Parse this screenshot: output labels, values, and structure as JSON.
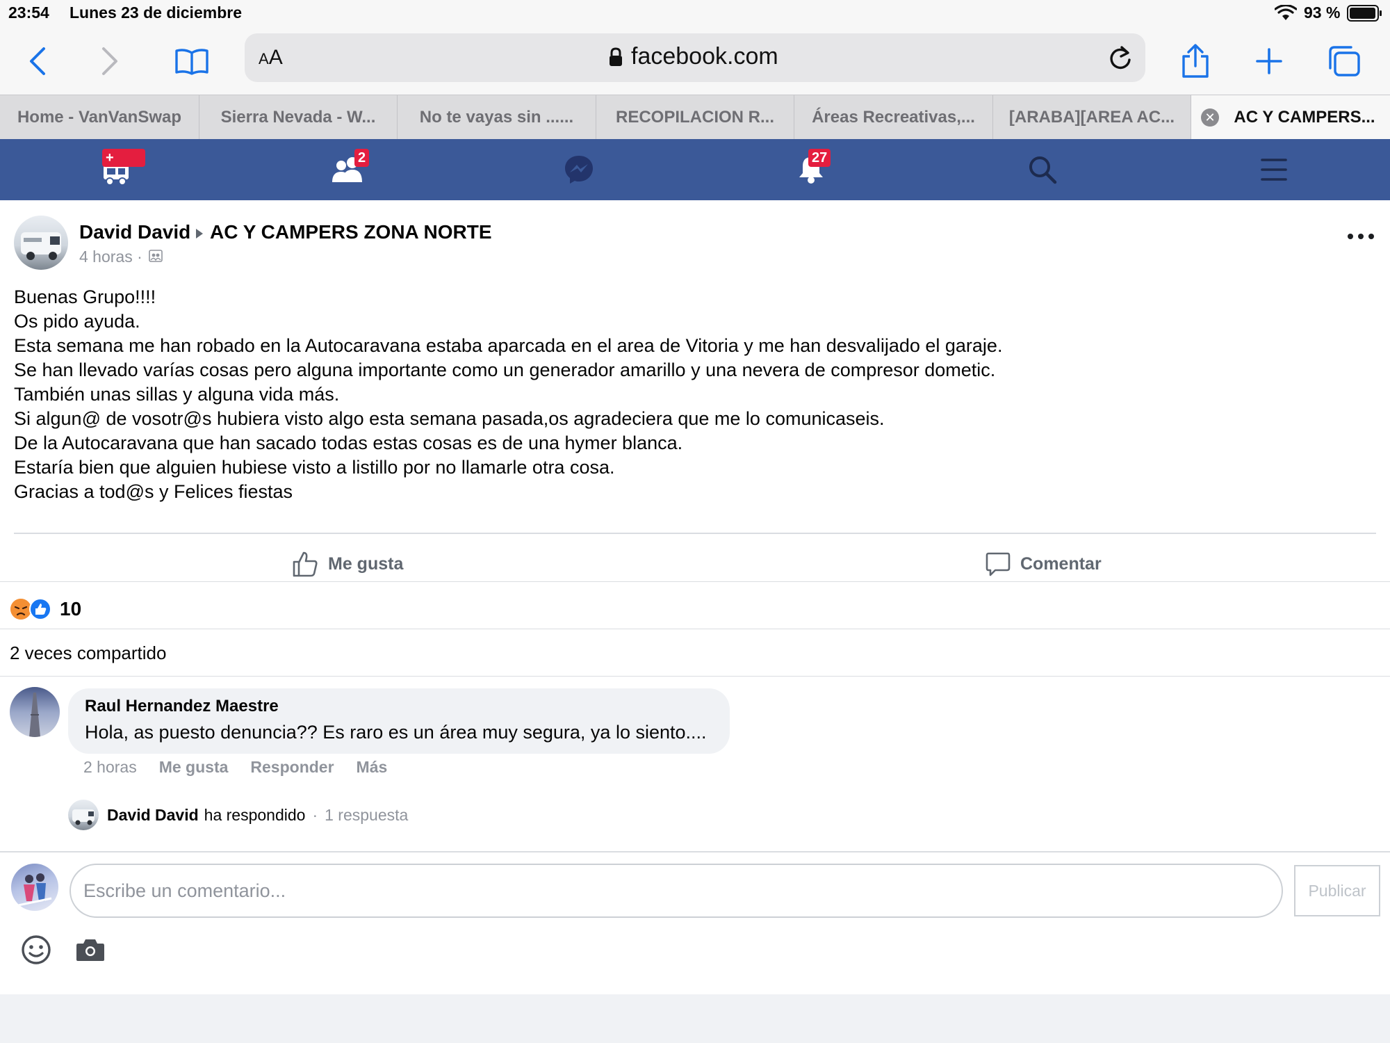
{
  "status_bar": {
    "time": "23:54",
    "date": "Lunes 23 de diciembre",
    "battery": "93 %"
  },
  "browser": {
    "text_size_label_small": "A",
    "text_size_label_large": "A",
    "url": "facebook.com",
    "tabs": [
      {
        "label": "Home - VanVanSwap"
      },
      {
        "label": "Sierra Nevada - W..."
      },
      {
        "label": "No te vayas sin ......"
      },
      {
        "label": "RECOPILACION R..."
      },
      {
        "label": "Áreas Recreativas,..."
      },
      {
        "label": "[ARABA][AREA AC..."
      },
      {
        "label": "AC Y CAMPERS..."
      }
    ]
  },
  "fb_nav": {
    "items": [
      {
        "icon": "camper-icon",
        "badge": "+"
      },
      {
        "icon": "friends-icon",
        "badge": "2"
      },
      {
        "icon": "messenger-icon",
        "badge": ""
      },
      {
        "icon": "notifications-icon",
        "badge": "27"
      },
      {
        "icon": "search-icon",
        "badge": ""
      },
      {
        "icon": "menu-icon",
        "badge": ""
      }
    ],
    "color": "#3b5998"
  },
  "post": {
    "author": "David David",
    "group": "AC Y CAMPERS ZONA NORTE",
    "time": "4 horas ·",
    "body": [
      "Buenas Grupo!!!!",
      "Os pido ayuda.",
      "Esta semana me han robado en la Autocaravana estaba aparcada en el area de Vitoria y me han desvalijado el garaje.",
      "Se han llevado varías cosas pero alguna importante como un generador amarillo y una nevera de compresor dometic.",
      "También unas sillas y alguna vida más.",
      "Si algun@ de vosotr@s hubiera visto algo esta semana pasada,os agradeciera que me lo comunicaseis.",
      "De la Autocaravana que han sacado todas estas cosas es de una hymer blanca.",
      "Estaría bien que alguien hubiese visto a listillo por no llamarle otra cosa.",
      "Gracias a tod@s y Felices fiestas"
    ],
    "like_label": "Me gusta",
    "comment_label": "Comentar",
    "reaction_count": "10",
    "shares": "2 veces compartido"
  },
  "comment": {
    "author": "Raul Hernandez Maestre",
    "text": "Hola, as puesto denuncia?? Es raro es un área muy segura, ya lo siento....",
    "time": "2 horas",
    "like": "Me gusta",
    "reply": "Responder",
    "more": "Más",
    "reply_summary": {
      "name": "David David",
      "action": "ha respondido",
      "separator": "·",
      "count": "1 respuesta"
    }
  },
  "composer": {
    "placeholder": "Escribe un comentario...",
    "publish": "Publicar"
  }
}
